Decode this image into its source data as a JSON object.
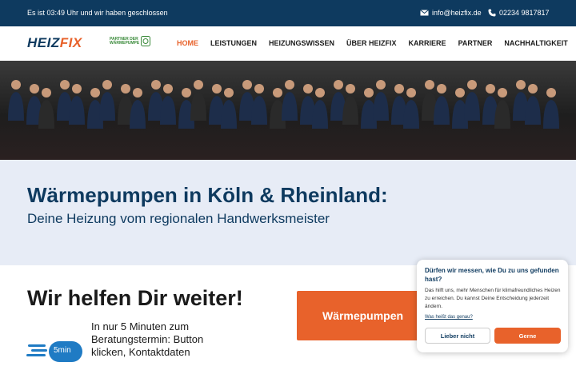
{
  "topbar": {
    "status": "Es ist 03:49 Uhr und wir haben geschlossen",
    "email": "info@heizfix.de",
    "phone": "02234 9817817"
  },
  "logo": {
    "part1": "HEIZ",
    "part2": "FIX"
  },
  "partner": {
    "line1": "Partner der",
    "line2": "Wärmepumpe"
  },
  "menu": {
    "items": [
      {
        "label": "HOME",
        "active": true
      },
      {
        "label": "LEISTUNGEN"
      },
      {
        "label": "HEIZUNGSWISSEN"
      },
      {
        "label": "ÜBER HEIZFIX"
      },
      {
        "label": "KARRIERE"
      },
      {
        "label": "PARTNER"
      },
      {
        "label": "NACHHALTIGKEIT"
      }
    ]
  },
  "hero": {
    "headline": "Wärmepumpen in Köln & Rheinland:",
    "subline": "Deine Heizung vom regionalen Handwerksmeister"
  },
  "section": {
    "title": "Wir helfen Dir weiter!",
    "cta": "Wärmepumpen",
    "badge": "5min",
    "text": "In nur 5 Minuten zum Beratungstermin: Button klicken, Kontaktdaten"
  },
  "consent": {
    "question": "Dürfen wir messen, wie Du zu uns gefunden hast?",
    "text": "Das hilft uns, mehr Menschen für klimafreundliches Heizen zu erreichen. Du kannst Deine Entscheidung jederzeit ändern.",
    "link": "Was heißt das genau?",
    "decline": "Lieber nicht",
    "accept": "Gerne"
  },
  "colors": {
    "navy": "#0e3a5f",
    "orange": "#e8622b",
    "band": "#e7ecf6"
  }
}
